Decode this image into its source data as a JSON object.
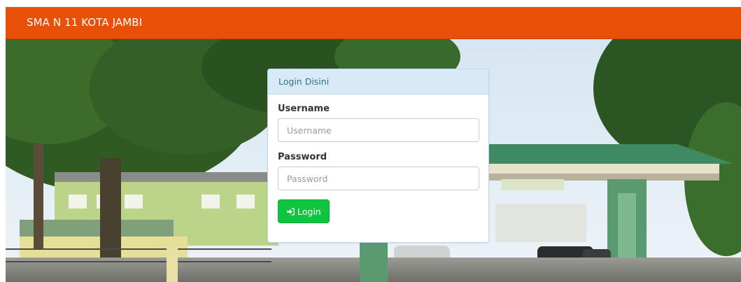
{
  "navbar": {
    "brand": "SMA N 11 KOTA JAMBI"
  },
  "login": {
    "heading": "Login Disini",
    "username_label": "Username",
    "username_placeholder": "Username",
    "username_value": "",
    "password_label": "Password",
    "password_placeholder": "Password",
    "password_value": "",
    "button_label": "Login",
    "button_icon": "sign-in-icon"
  },
  "colors": {
    "navbar": "#e8500a",
    "panel_heading_bg": "#d9eaf7",
    "panel_heading_text": "#31708f",
    "login_button": "#0ec440"
  }
}
